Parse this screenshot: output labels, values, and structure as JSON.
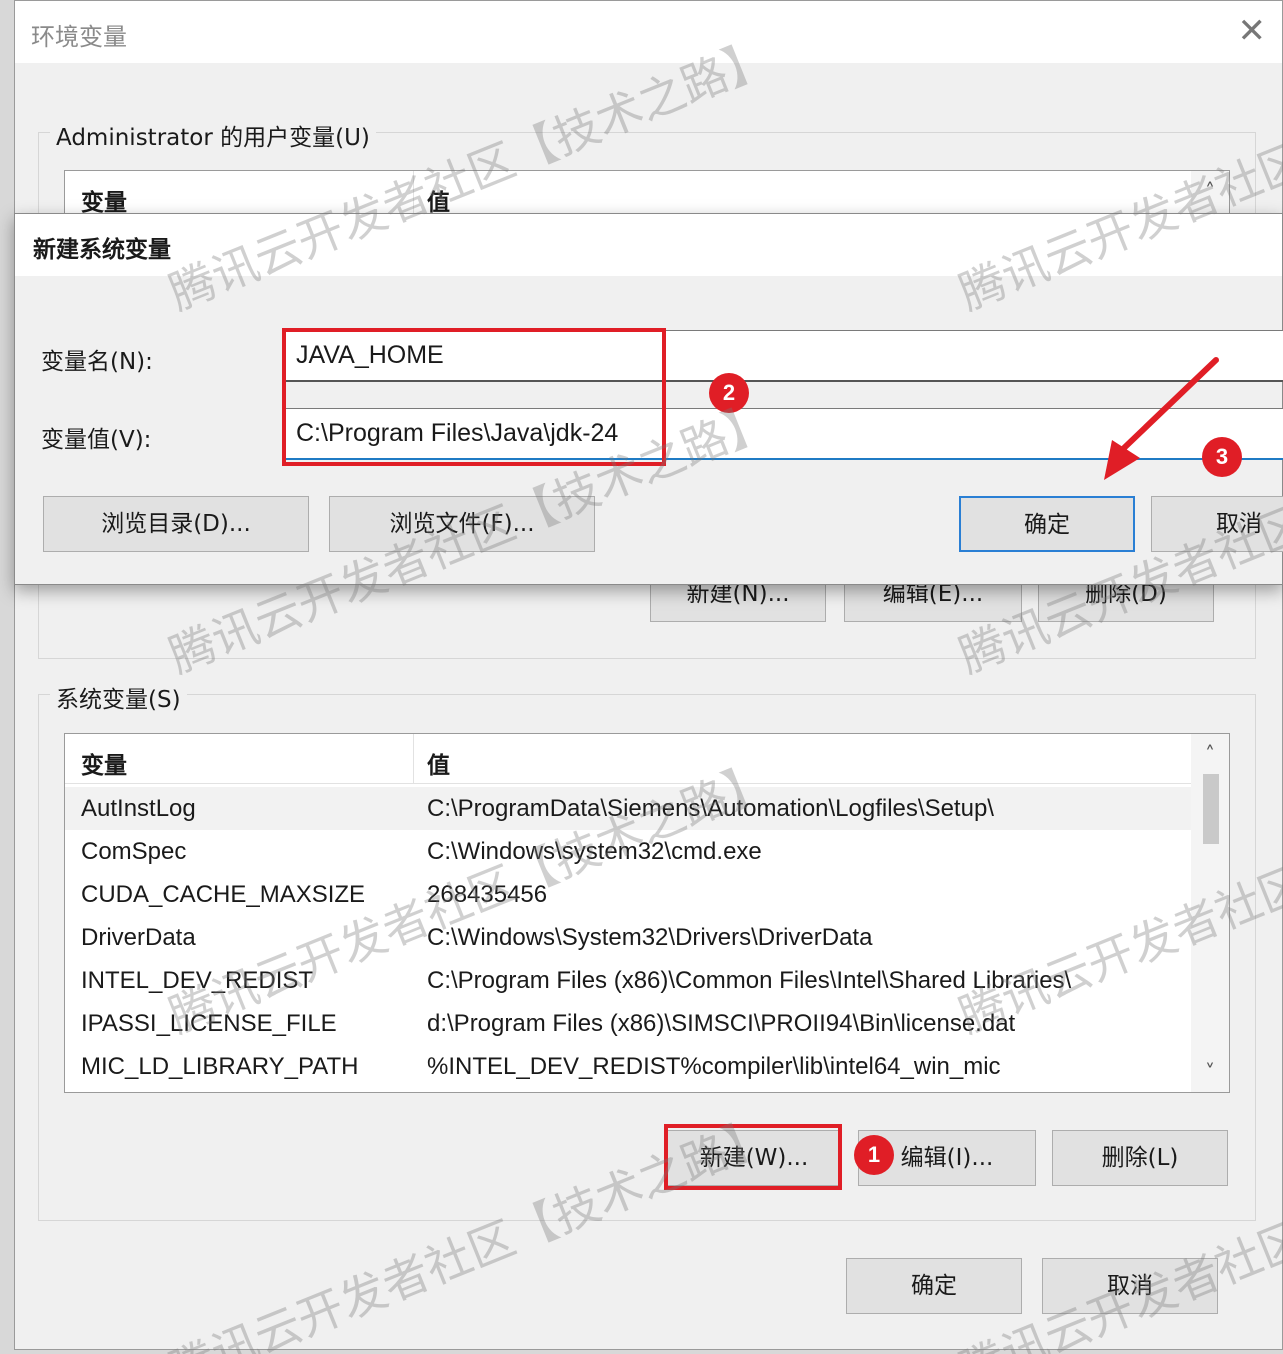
{
  "env_window": {
    "title": "环境变量",
    "close_glyph": "✕",
    "user_group": {
      "label": "Administrator 的用户变量(U)",
      "col_var": "变量",
      "col_val": "值",
      "buttons": {
        "new": "新建(N)...",
        "edit": "编辑(E)...",
        "delete": "删除(D)"
      }
    },
    "sys_group": {
      "label": "系统变量(S)",
      "col_var": "变量",
      "col_val": "值",
      "rows": [
        {
          "name": "AutInstLog",
          "value": "C:\\ProgramData\\Siemens\\Automation\\Logfiles\\Setup\\"
        },
        {
          "name": "ComSpec",
          "value": "C:\\Windows\\system32\\cmd.exe"
        },
        {
          "name": "CUDA_CACHE_MAXSIZE",
          "value": "268435456"
        },
        {
          "name": "DriverData",
          "value": "C:\\Windows\\System32\\Drivers\\DriverData"
        },
        {
          "name": "INTEL_DEV_REDIST",
          "value": "C:\\Program Files (x86)\\Common Files\\Intel\\Shared Libraries\\"
        },
        {
          "name": "IPASSI_LICENSE_FILE",
          "value": "d:\\Program Files (x86)\\SIMSCI\\PROII94\\Bin\\license.dat"
        },
        {
          "name": "MIC_LD_LIBRARY_PATH",
          "value": "%INTEL_DEV_REDIST%compiler\\lib\\intel64_win_mic"
        }
      ],
      "buttons": {
        "new": "新建(W)...",
        "edit": "编辑(I)...",
        "delete": "删除(L)"
      }
    },
    "footer": {
      "ok": "确定",
      "cancel": "取消"
    }
  },
  "new_dialog": {
    "title": "新建系统变量",
    "name_label": "变量名(N):",
    "name_value": "JAVA_HOME",
    "value_label": "变量值(V):",
    "value_value": "C:\\Program Files\\Java\\jdk-24",
    "buttons": {
      "browse_dir": "浏览目录(D)...",
      "browse_file": "浏览文件(F)...",
      "ok": "确定",
      "cancel": "取消"
    }
  },
  "annotations": {
    "badge_1": "1",
    "badge_2": "2",
    "badge_3": "3",
    "highlight_color": "#e01e26"
  },
  "watermark": "腾讯云开发者社区【技术之路】",
  "scroll_up_glyph": "˄",
  "scroll_down_glyph": "˅"
}
